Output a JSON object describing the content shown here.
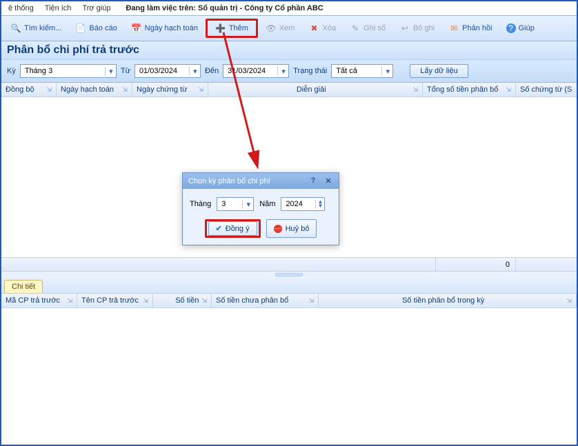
{
  "menubar": {
    "items": [
      "ệ thống",
      "Tiện ích",
      "Trợ giúp"
    ],
    "working_prefix": "Đang làm việc trên:",
    "working_value": "Sổ quản trị - Công ty Cổ phần ABC"
  },
  "toolbar": {
    "search": "Tìm kiếm...",
    "report": "Báo cáo",
    "accounting_date": "Ngày hạch toán",
    "add": "Thêm",
    "view": "Xem",
    "delete": "Xóa",
    "record": "Ghi sổ",
    "unrecord": "Bỏ ghi",
    "feedback": "Phản hồi",
    "help": "Giúp",
    "icons": {
      "search": "🔍",
      "report": "📄",
      "date": "📅",
      "add": "➕",
      "view": "👁",
      "delete": "✖",
      "pen": "✎",
      "unrecord": "↩",
      "feedback": "✉",
      "help": "?"
    }
  },
  "page_title": "Phân bổ chi phí trả trước",
  "filters": {
    "period_label": "Kỳ",
    "period_value": "Tháng 3",
    "from_label": "Từ",
    "from_value": "01/03/2024",
    "to_label": "Đến",
    "to_value": "31/03/2024",
    "status_label": "Trạng thái",
    "status_value": "Tất cả",
    "fetch_btn": "Lấy dữ liệu"
  },
  "grid1": {
    "cols": [
      "Đồng bộ",
      "Ngày hạch toán",
      "Ngày chứng từ",
      "Diễn giải",
      "Tổng số tiền phân bổ",
      "Số chứng từ (S"
    ],
    "total_value": "0"
  },
  "tab_detail": "Chi tiết",
  "grid2": {
    "cols": [
      "Mã CP trả trước",
      "Tên CP trả trước",
      "Số tiền",
      "Số tiền chưa phân bổ",
      "Số tiền phân bổ trong kỳ"
    ]
  },
  "dialog": {
    "title": "Chọn kỳ phân bổ chi phí",
    "help_icon": "?",
    "close_icon": "✕",
    "month_label": "Tháng",
    "month_value": "3",
    "year_label": "Năm",
    "year_value": "2024",
    "ok": "Đồng ý",
    "cancel": "Huỷ bỏ"
  }
}
